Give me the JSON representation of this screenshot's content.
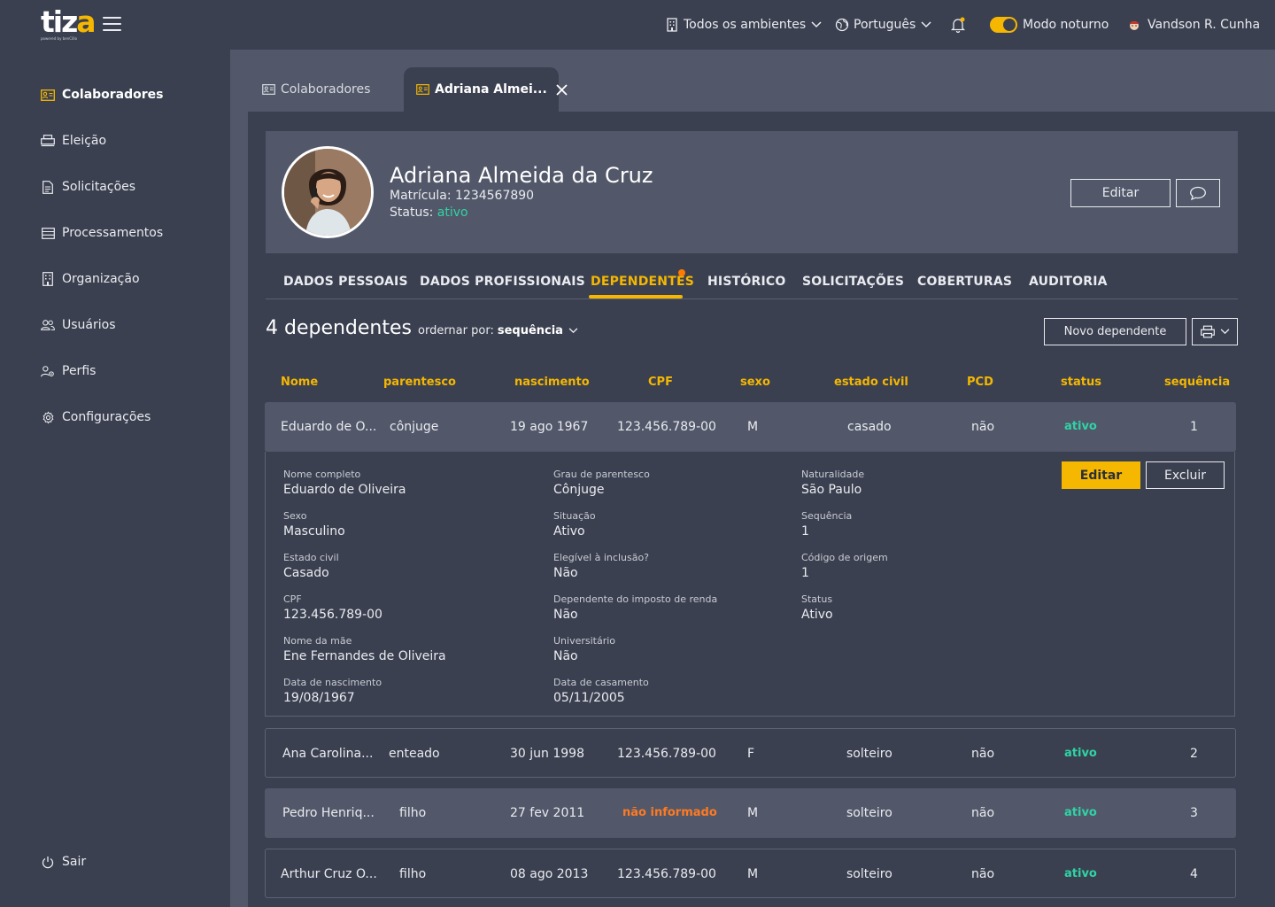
{
  "app": {
    "logo_text": "tiza",
    "logo_subtitle": "powered by benCôlo"
  },
  "topbar": {
    "environment": "Todos os ambientes",
    "language": "Português",
    "dark_mode_label": "Modo noturno",
    "user_name": "Vandson R. Cunha"
  },
  "sidebar": {
    "items": [
      {
        "label": "Colaboradores",
        "icon": "id-card-icon",
        "active": true
      },
      {
        "label": "Eleição",
        "icon": "printer-icon"
      },
      {
        "label": "Solicitações",
        "icon": "document-icon"
      },
      {
        "label": "Processamentos",
        "icon": "list-icon"
      },
      {
        "label": "Organização",
        "icon": "building-icon"
      },
      {
        "label": "Usuários",
        "icon": "users-icon"
      },
      {
        "label": "Perfis",
        "icon": "user-gear-icon"
      },
      {
        "label": "Configurações",
        "icon": "gear-icon"
      }
    ],
    "logout": "Sair"
  },
  "tabs": [
    {
      "label": "Colaboradores"
    },
    {
      "label": "Adriana Almei..."
    }
  ],
  "employee": {
    "name": "Adriana Almeida da Cruz",
    "registration_label": "Matrícula:",
    "registration": "1234567890",
    "status_label": "Status:",
    "status": "ativo",
    "edit_label": "Editar"
  },
  "section_tabs": [
    "DADOS PESSOAIS",
    "DADOS PROFISSIONAIS",
    "DEPENDENTES",
    "HISTÓRICO",
    "SOLICITAÇÕES",
    "COBERTURAS",
    "AUDITORIA"
  ],
  "dependents": {
    "count_label": "4 dependentes",
    "order_label": "ordernar por:",
    "order_value": "sequência",
    "new_label": "Novo dependente",
    "columns": [
      "Nome",
      "parentesco",
      "nascimento",
      "CPF",
      "sexo",
      "estado civil",
      "PCD",
      "status",
      "sequência"
    ],
    "rows": [
      [
        "Eduardo de O...",
        "cônjuge",
        "19 ago 1967",
        "123.456.789-00",
        "M",
        "casado",
        "não",
        "ativo",
        "1"
      ],
      [
        "Ana Carolina...",
        "enteado",
        "30 jun 1998",
        "123.456.789-00",
        "F",
        "solteiro",
        "não",
        "ativo",
        "2"
      ],
      [
        "Pedro Henriq...",
        "filho",
        "27 fev 2011",
        "não informado",
        "M",
        "solteiro",
        "não",
        "ativo",
        "3"
      ],
      [
        "Arthur Cruz O...",
        "filho",
        "08 ago 2013",
        "123.456.789-00",
        "M",
        "solteiro",
        "não",
        "ativo",
        "4"
      ]
    ]
  },
  "detail": {
    "edit_label": "Editar",
    "delete_label": "Excluir",
    "col1": [
      {
        "label": "Nome completo",
        "value": "Eduardo de Oliveira"
      },
      {
        "label": "Sexo",
        "value": "Masculino"
      },
      {
        "label": "Estado civil",
        "value": "Casado"
      },
      {
        "label": "CPF",
        "value": "123.456.789-00"
      },
      {
        "label": "Nome da mãe",
        "value": "Ene Fernandes de Oliveira"
      },
      {
        "label": "Data de nascimento",
        "value": "19/08/1967"
      }
    ],
    "col2": [
      {
        "label": "Grau de parentesco",
        "value": "Cônjuge"
      },
      {
        "label": "Situação",
        "value": "Ativo"
      },
      {
        "label": "Elegível à inclusão?",
        "value": "Não"
      },
      {
        "label": "Dependente do imposto de renda",
        "value": "Não"
      },
      {
        "label": "Universitário",
        "value": "Não"
      },
      {
        "label": "Data de casamento",
        "value": "05/11/2005"
      }
    ],
    "col3": [
      {
        "label": "Naturalidade",
        "value": "São Paulo"
      },
      {
        "label": "Sequência",
        "value": "1"
      },
      {
        "label": "Código de origem",
        "value": "1"
      },
      {
        "label": "Status",
        "value": "Ativo"
      }
    ]
  },
  "colors": {
    "accent": "#f5b700",
    "active_green": "#2fd3a6",
    "warning_orange": "#ff7a22"
  }
}
